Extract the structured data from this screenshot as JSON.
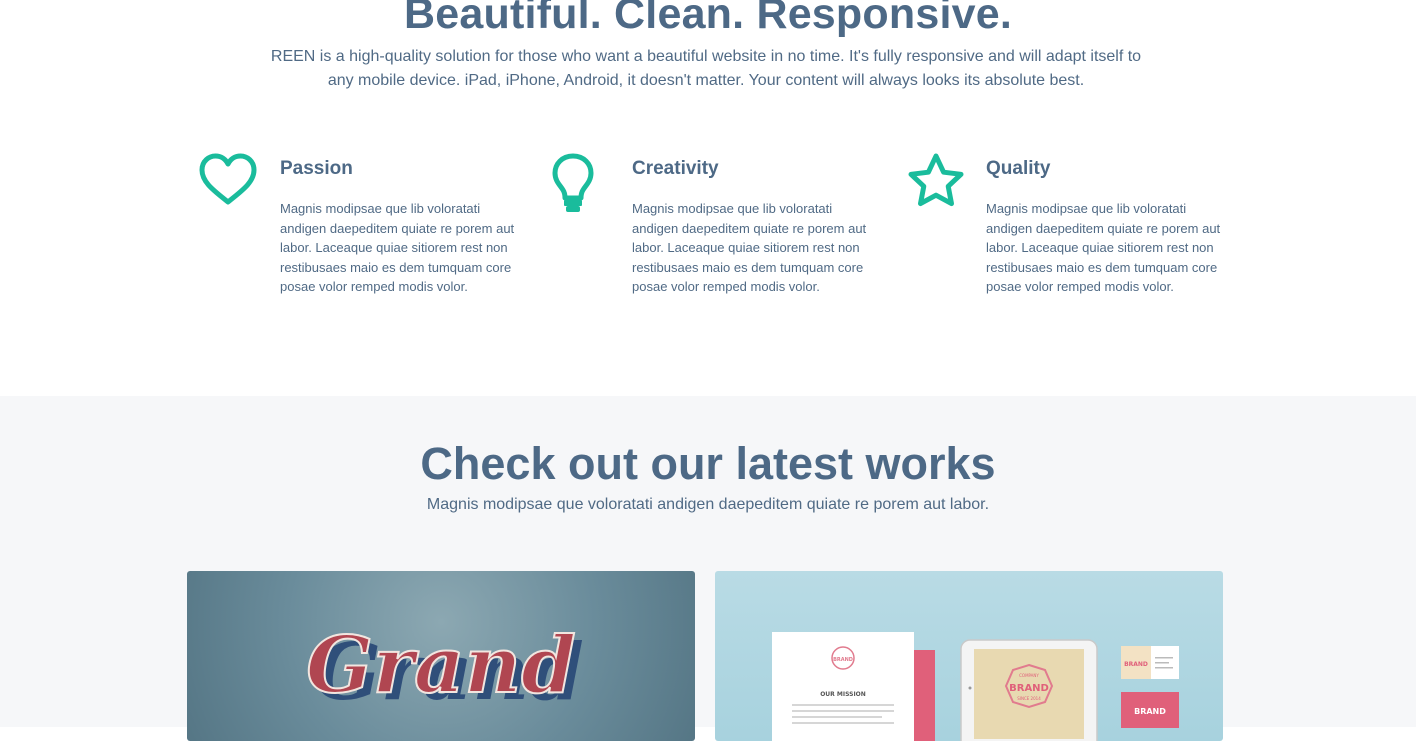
{
  "hero": {
    "title": "Beautiful. Clean. Responsive.",
    "subtitle": "REEN is a high-quality solution for those who want a beautiful website in no time. It's fully responsive and will adapt itself to any mobile device. iPad, iPhone, Android, it doesn't matter. Your content will always looks its absolute best."
  },
  "features": [
    {
      "icon": "heart-icon",
      "title": "Passion",
      "text": "Magnis modipsae que lib voloratati andigen daepeditem quiate re porem aut labor. Laceaque quiae sitiorem rest non restibusaes maio es dem tumquam core posae volor remped modis volor."
    },
    {
      "icon": "lightbulb-icon",
      "title": "Creativity",
      "text": "Magnis modipsae que lib voloratati andigen daepeditem quiate re porem aut labor. Laceaque quiae sitiorem rest non restibusaes maio es dem tumquam core posae volor remped modis volor."
    },
    {
      "icon": "star-icon",
      "title": "Quality",
      "text": "Magnis modipsae que lib voloratati andigen daepeditem quiate re porem aut labor. Laceaque quiae sitiorem rest non restibusaes maio es dem tumquam core posae volor remped modis volor."
    }
  ],
  "works": {
    "title": "Check out our latest works",
    "subtitle": "Magnis modipsae que voloratati andigen daepeditem quiate re porem aut labor.",
    "items": [
      {
        "image_text": "Grand"
      },
      {
        "doc_heading": "OUR MISSION",
        "brand_label": "BRAND",
        "badge_top": "COMPANY",
        "badge_bottom": "SINCE 2014"
      }
    ]
  },
  "colors": {
    "accent": "#1abc9c",
    "heading": "#4d6986",
    "body": "#506a85",
    "section_bg": "#f6f7f9"
  }
}
